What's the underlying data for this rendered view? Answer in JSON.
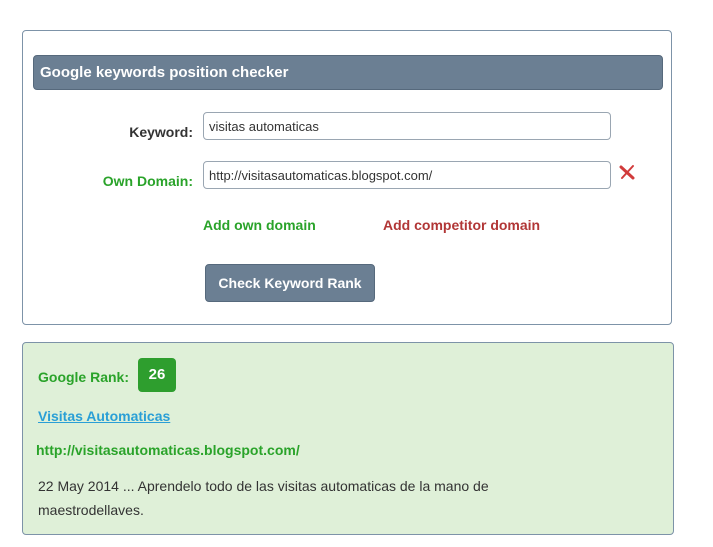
{
  "form": {
    "title": "Google keywords position checker",
    "keyword_label": "Keyword:",
    "keyword_value": "visitas automaticas",
    "domain_label": "Own Domain:",
    "domain_value": "http://visitasautomaticas.blogspot.com/",
    "add_own_domain": "Add own domain",
    "add_competitor_domain": "Add competitor domain",
    "check_button": "Check Keyword Rank",
    "remove_icon": "remove-x-icon"
  },
  "result": {
    "rank_label": "Google Rank:",
    "rank_value": "26",
    "title": "Visitas Automaticas",
    "url": "http://visitasautomaticas.blogspot.com/",
    "snippet": "22 May 2014 ... Aprendelo todo de las visitas automaticas de la mano de maestrodellaves."
  },
  "colors": {
    "header_bg": "#6b7f93",
    "green": "#2aa32a",
    "red": "#b13636",
    "link_blue": "#2a9fd6",
    "result_bg": "#dff0d8"
  }
}
